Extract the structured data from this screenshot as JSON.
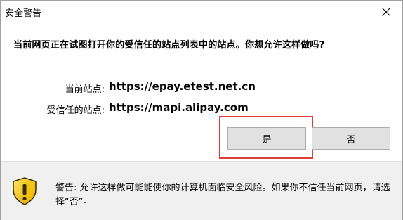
{
  "window": {
    "title": "安全警告",
    "close_icon": "close-icon"
  },
  "dialog": {
    "question": "当前网页正在试图打开你的受信任的站点列表中的站点。你想允许这样做吗?",
    "current_site_label": "当前站点:",
    "current_site_value": "https://epay.etest.net.cn",
    "trusted_site_label": "受信任的站点:",
    "trusted_site_value": "https://mapi.alipay.com",
    "yes_label": "是",
    "no_label": "否"
  },
  "footer": {
    "icon": "shield-warning-icon",
    "warning_text": "警告: 允许这样做可能能使你的计算机面临安全风险。如果你不信任当前网页，请选择“否”。"
  },
  "colors": {
    "highlight": "#e03c3c",
    "shield_yellow": "#f5c400",
    "shield_dark": "#3a2c00"
  }
}
